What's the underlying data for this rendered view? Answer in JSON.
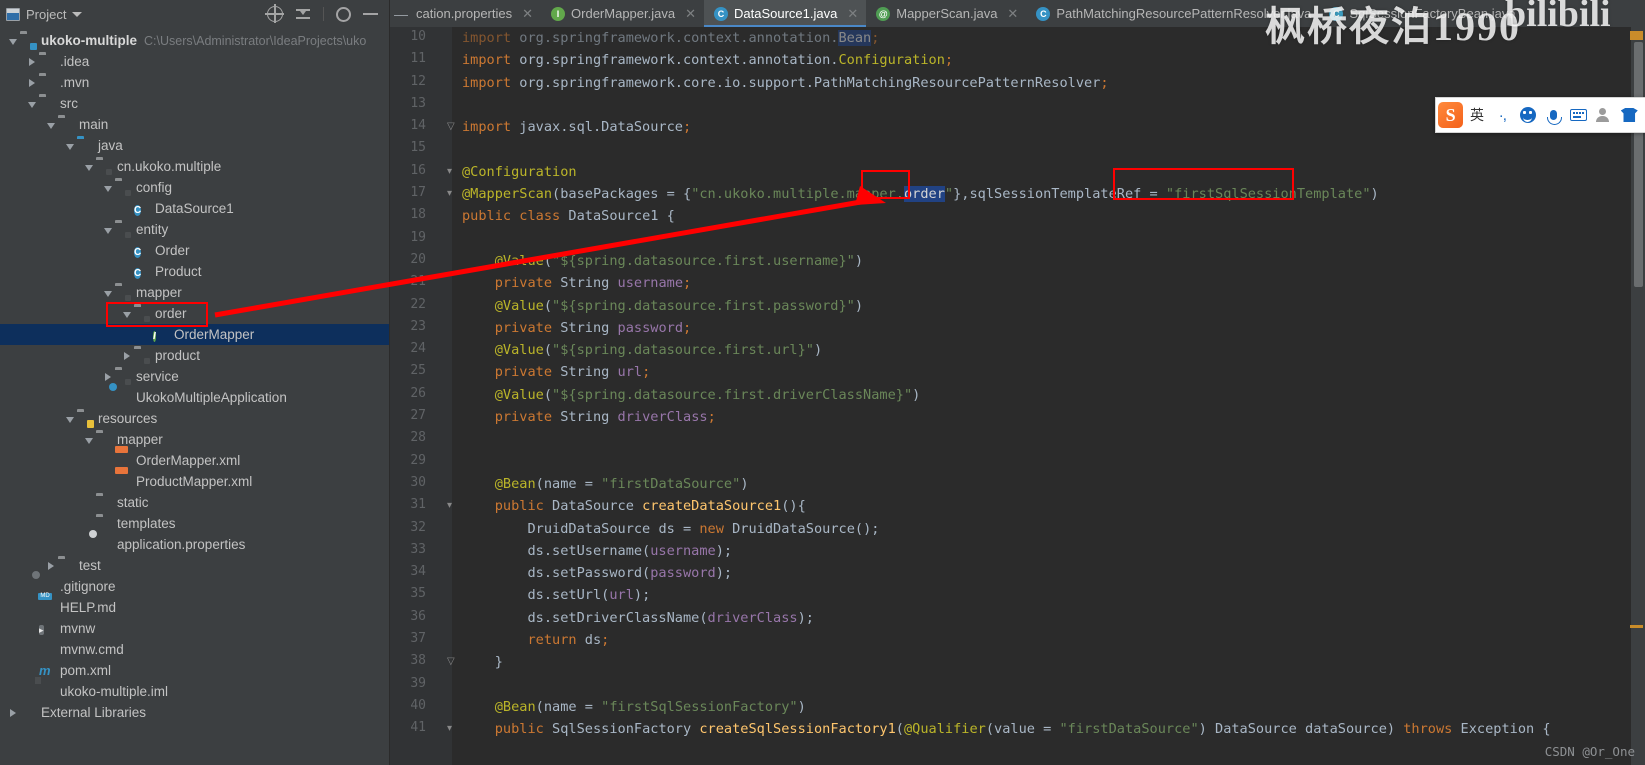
{
  "project_panel": {
    "title": "Project",
    "header_icons": [
      "locate-icon",
      "collapse-all-icon",
      "settings-icon",
      "minimize-icon"
    ],
    "tree": [
      {
        "depth": 0,
        "arrow": "down",
        "icon": "module-folder-icon",
        "label": "ukoko-multiple",
        "bold": true,
        "sub": "C:\\Users\\Administrator\\IdeaProjects\\uko"
      },
      {
        "depth": 1,
        "arrow": "right",
        "icon": "folder-icon",
        "label": ".idea"
      },
      {
        "depth": 1,
        "arrow": "right",
        "icon": "folder-icon",
        "label": ".mvn"
      },
      {
        "depth": 1,
        "arrow": "down",
        "icon": "folder-icon",
        "label": "src"
      },
      {
        "depth": 2,
        "arrow": "down",
        "icon": "folder-icon",
        "label": "main"
      },
      {
        "depth": 3,
        "arrow": "down",
        "icon": "source-folder-icon",
        "label": "java"
      },
      {
        "depth": 4,
        "arrow": "down",
        "icon": "package-icon",
        "label": "cn.ukoko.multiple"
      },
      {
        "depth": 5,
        "arrow": "down",
        "icon": "package-icon",
        "label": "config"
      },
      {
        "depth": 6,
        "arrow": "none",
        "icon": "java-class-icon",
        "label": "DataSource1"
      },
      {
        "depth": 5,
        "arrow": "down",
        "icon": "package-icon",
        "label": "entity"
      },
      {
        "depth": 6,
        "arrow": "none",
        "icon": "java-class-icon",
        "label": "Order"
      },
      {
        "depth": 6,
        "arrow": "none",
        "icon": "java-class-icon",
        "label": "Product"
      },
      {
        "depth": 5,
        "arrow": "down",
        "icon": "package-icon",
        "label": "mapper"
      },
      {
        "depth": 6,
        "arrow": "down",
        "icon": "package-icon",
        "label": "order",
        "highlighted": true
      },
      {
        "depth": 7,
        "arrow": "none",
        "icon": "java-interface-icon",
        "label": "OrderMapper",
        "selected": true
      },
      {
        "depth": 6,
        "arrow": "right",
        "icon": "package-icon",
        "label": "product"
      },
      {
        "depth": 5,
        "arrow": "right",
        "icon": "package-icon",
        "label": "service"
      },
      {
        "depth": 5,
        "arrow": "none",
        "icon": "spring-boot-icon",
        "label": "UkokoMultipleApplication"
      },
      {
        "depth": 3,
        "arrow": "down",
        "icon": "resources-folder-icon",
        "label": "resources"
      },
      {
        "depth": 4,
        "arrow": "down",
        "icon": "folder-icon",
        "label": "mapper"
      },
      {
        "depth": 5,
        "arrow": "none",
        "icon": "xml-file-icon",
        "label": "OrderMapper.xml"
      },
      {
        "depth": 5,
        "arrow": "none",
        "icon": "xml-file-icon",
        "label": "ProductMapper.xml"
      },
      {
        "depth": 4,
        "arrow": "none",
        "icon": "folder-icon",
        "label": "static"
      },
      {
        "depth": 4,
        "arrow": "none",
        "icon": "folder-icon",
        "label": "templates"
      },
      {
        "depth": 4,
        "arrow": "none",
        "icon": "properties-file-icon",
        "label": "application.properties"
      },
      {
        "depth": 2,
        "arrow": "right",
        "icon": "folder-icon",
        "label": "test"
      },
      {
        "depth": 1,
        "arrow": "none",
        "icon": "gitignore-file-icon",
        "label": ".gitignore"
      },
      {
        "depth": 1,
        "arrow": "none",
        "icon": "markdown-file-icon",
        "label": "HELP.md"
      },
      {
        "depth": 1,
        "arrow": "none",
        "icon": "shell-file-icon",
        "label": "mvnw"
      },
      {
        "depth": 1,
        "arrow": "none",
        "icon": "cmd-file-icon",
        "label": "mvnw.cmd"
      },
      {
        "depth": 1,
        "arrow": "none",
        "icon": "maven-file-icon",
        "label": "pom.xml"
      },
      {
        "depth": 1,
        "arrow": "none",
        "icon": "iml-file-icon",
        "label": "ukoko-multiple.iml"
      },
      {
        "depth": 0,
        "arrow": "right",
        "icon": "library-icon",
        "label": "External Libraries"
      }
    ]
  },
  "tabs": [
    {
      "label": "cation.properties",
      "icon": "dash-icon",
      "icon_color": "#9aa0a6",
      "active": false,
      "closable": true
    },
    {
      "label": "OrderMapper.java",
      "icon": "java-interface-icon",
      "icon_color": "#62a84b",
      "active": false,
      "closable": true
    },
    {
      "label": "DataSource1.java",
      "icon": "java-class-icon",
      "icon_color": "#3592c4",
      "active": true,
      "closable": true
    },
    {
      "label": "MapperScan.java",
      "icon": "java-annotation-icon",
      "icon_color": "#4f9d53",
      "active": false,
      "closable": true
    },
    {
      "label": "PathMatchingResourcePatternResolver.java",
      "icon": "java-class-icon",
      "icon_color": "#3592c4",
      "active": false,
      "closable": false
    },
    {
      "label": "SqlSessionFactoryBean.java",
      "icon": "java-class-icon",
      "icon_color": "#3da0c4",
      "active": false,
      "closable": false
    }
  ],
  "editor": {
    "first_line_number": 10,
    "lines": [
      {
        "n": 10,
        "dim": true,
        "tokens": [
          {
            "t": "import ",
            "c": "kw"
          },
          {
            "t": "org.springframework.context.annotation.",
            "c": "pl"
          },
          {
            "t": "Bean",
            "c": "sel"
          },
          {
            "t": ";",
            "c": "sem"
          }
        ]
      },
      {
        "n": 11,
        "tokens": [
          {
            "t": "import ",
            "c": "kw"
          },
          {
            "t": "org.springframework.context.annotation.",
            "c": "pl"
          },
          {
            "t": "Configuration",
            "c": "ann"
          },
          {
            "t": ";",
            "c": "sem"
          }
        ]
      },
      {
        "n": 12,
        "tokens": [
          {
            "t": "import ",
            "c": "kw"
          },
          {
            "t": "org.springframework.core.io.support.PathMatchingResourcePatternResolver",
            "c": "pl"
          },
          {
            "t": ";",
            "c": "sem"
          }
        ]
      },
      {
        "n": 13,
        "tokens": []
      },
      {
        "n": 14,
        "fold": "end",
        "tokens": [
          {
            "t": "import ",
            "c": "kw"
          },
          {
            "t": "javax.sql.DataSource",
            "c": "pl"
          },
          {
            "t": ";",
            "c": "sem"
          }
        ]
      },
      {
        "n": 15,
        "tokens": []
      },
      {
        "n": 16,
        "fold": "start",
        "tokens": [
          {
            "t": "@Configuration",
            "c": "ann"
          }
        ]
      },
      {
        "n": 17,
        "fold": "start",
        "tokens": [
          {
            "t": "@MapperScan",
            "c": "ann"
          },
          {
            "t": "(",
            "c": "pl"
          },
          {
            "t": "basePackages",
            "c": "pl"
          },
          {
            "t": " = {",
            "c": "pl"
          },
          {
            "t": "\"cn.ukoko.multiple.mapper.",
            "c": "str"
          },
          {
            "t": "order",
            "c": "sel-blue"
          },
          {
            "t": "\"",
            "c": "str"
          },
          {
            "t": "},",
            "c": "pl"
          },
          {
            "t": "sqlSessionTemplateRef",
            "c": "pl"
          },
          {
            "t": " = ",
            "c": "pl"
          },
          {
            "t": "\"firstSqlSessionTemplate\"",
            "c": "str"
          },
          {
            "t": ")",
            "c": "pl"
          }
        ]
      },
      {
        "n": 18,
        "mark": "bean-blue",
        "tokens": [
          {
            "t": "public ",
            "c": "kw"
          },
          {
            "t": "class ",
            "c": "kw"
          },
          {
            "t": "DataSource1",
            "c": "cls"
          },
          {
            "t": " {",
            "c": "pl"
          }
        ]
      },
      {
        "n": 19,
        "tokens": []
      },
      {
        "n": 20,
        "indent": 1,
        "tokens": [
          {
            "t": "@Value",
            "c": "ann"
          },
          {
            "t": "(",
            "c": "pl"
          },
          {
            "t": "\"${spring.datasource.first.username}\"",
            "c": "str"
          },
          {
            "t": ")",
            "c": "pl"
          }
        ]
      },
      {
        "n": 21,
        "indent": 1,
        "tokens": [
          {
            "t": "private ",
            "c": "kw"
          },
          {
            "t": "String ",
            "c": "cls"
          },
          {
            "t": "username",
            "c": "fld"
          },
          {
            "t": ";",
            "c": "sem"
          }
        ]
      },
      {
        "n": 22,
        "indent": 1,
        "tokens": [
          {
            "t": "@Value",
            "c": "ann"
          },
          {
            "t": "(",
            "c": "pl"
          },
          {
            "t": "\"${spring.datasource.first.password}\"",
            "c": "str"
          },
          {
            "t": ")",
            "c": "pl"
          }
        ]
      },
      {
        "n": 23,
        "indent": 1,
        "tokens": [
          {
            "t": "private ",
            "c": "kw"
          },
          {
            "t": "String ",
            "c": "cls"
          },
          {
            "t": "password",
            "c": "fld"
          },
          {
            "t": ";",
            "c": "sem"
          }
        ]
      },
      {
        "n": 24,
        "indent": 1,
        "tokens": [
          {
            "t": "@Value",
            "c": "ann"
          },
          {
            "t": "(",
            "c": "pl"
          },
          {
            "t": "\"${spring.datasource.first.url}\"",
            "c": "str"
          },
          {
            "t": ")",
            "c": "pl"
          }
        ]
      },
      {
        "n": 25,
        "indent": 1,
        "tokens": [
          {
            "t": "private ",
            "c": "kw"
          },
          {
            "t": "String ",
            "c": "cls"
          },
          {
            "t": "url",
            "c": "fld"
          },
          {
            "t": ";",
            "c": "sem"
          }
        ]
      },
      {
        "n": 26,
        "indent": 1,
        "tokens": [
          {
            "t": "@Value",
            "c": "ann"
          },
          {
            "t": "(",
            "c": "pl"
          },
          {
            "t": "\"${spring.datasource.first.driverClassName}\"",
            "c": "str"
          },
          {
            "t": ")",
            "c": "pl"
          }
        ]
      },
      {
        "n": 27,
        "indent": 1,
        "tokens": [
          {
            "t": "private ",
            "c": "kw"
          },
          {
            "t": "String ",
            "c": "cls"
          },
          {
            "t": "driverClass",
            "c": "fld"
          },
          {
            "t": ";",
            "c": "sem"
          }
        ]
      },
      {
        "n": 28,
        "tokens": []
      },
      {
        "n": 29,
        "tokens": []
      },
      {
        "n": 30,
        "indent": 1,
        "mark": "bean-green",
        "tokens": [
          {
            "t": "@Bean",
            "c": "ann"
          },
          {
            "t": "(",
            "c": "pl"
          },
          {
            "t": "name",
            "c": "pl"
          },
          {
            "t": " = ",
            "c": "pl"
          },
          {
            "t": "\"firstDataSource\"",
            "c": "str"
          },
          {
            "t": ")",
            "c": "pl"
          }
        ]
      },
      {
        "n": 31,
        "indent": 1,
        "fold": "start",
        "tokens": [
          {
            "t": "public ",
            "c": "kw"
          },
          {
            "t": "DataSource ",
            "c": "cls"
          },
          {
            "t": "createDataSource1",
            "c": "mth"
          },
          {
            "t": "(){",
            "c": "pl"
          }
        ]
      },
      {
        "n": 32,
        "indent": 2,
        "tokens": [
          {
            "t": "DruidDataSource ",
            "c": "cls"
          },
          {
            "t": "ds",
            "c": "pl"
          },
          {
            "t": " = ",
            "c": "pl"
          },
          {
            "t": "new ",
            "c": "kw"
          },
          {
            "t": "DruidDataSource();",
            "c": "pl"
          }
        ]
      },
      {
        "n": 33,
        "indent": 2,
        "tokens": [
          {
            "t": "ds.setUsername(",
            "c": "pl"
          },
          {
            "t": "username",
            "c": "fld"
          },
          {
            "t": ");",
            "c": "pl"
          }
        ]
      },
      {
        "n": 34,
        "indent": 2,
        "tokens": [
          {
            "t": "ds.setPassword(",
            "c": "pl"
          },
          {
            "t": "password",
            "c": "fld"
          },
          {
            "t": ");",
            "c": "pl"
          }
        ]
      },
      {
        "n": 35,
        "indent": 2,
        "tokens": [
          {
            "t": "ds.setUrl(",
            "c": "pl"
          },
          {
            "t": "url",
            "c": "fld"
          },
          {
            "t": ");",
            "c": "pl"
          }
        ]
      },
      {
        "n": 36,
        "indent": 2,
        "tokens": [
          {
            "t": "ds.setDriverClassName(",
            "c": "pl"
          },
          {
            "t": "driverClass",
            "c": "fld"
          },
          {
            "t": ");",
            "c": "pl"
          }
        ]
      },
      {
        "n": 37,
        "indent": 2,
        "tokens": [
          {
            "t": "return ",
            "c": "kw"
          },
          {
            "t": "ds",
            "c": "pl"
          },
          {
            "t": ";",
            "c": "sem"
          }
        ]
      },
      {
        "n": 38,
        "indent": 1,
        "fold": "end",
        "tokens": [
          {
            "t": "}",
            "c": "pl"
          }
        ]
      },
      {
        "n": 39,
        "tokens": []
      },
      {
        "n": 40,
        "indent": 1,
        "mark": "bean-green",
        "tokens": [
          {
            "t": "@Bean",
            "c": "ann"
          },
          {
            "t": "(",
            "c": "pl"
          },
          {
            "t": "name",
            "c": "pl"
          },
          {
            "t": " = ",
            "c": "pl"
          },
          {
            "t": "\"firstSqlSessionFactory\"",
            "c": "str"
          },
          {
            "t": ")",
            "c": "pl"
          }
        ]
      },
      {
        "n": 41,
        "indent": 1,
        "mark": "bean-green2",
        "fold": "start",
        "tokens": [
          {
            "t": "public ",
            "c": "kw"
          },
          {
            "t": "SqlSessionFactory ",
            "c": "cls"
          },
          {
            "t": "createSqlSessionFactory1",
            "c": "mth"
          },
          {
            "t": "(",
            "c": "pl"
          },
          {
            "t": "@Qualifier",
            "c": "ann"
          },
          {
            "t": "(",
            "c": "pl"
          },
          {
            "t": "value",
            "c": "pl"
          },
          {
            "t": " = ",
            "c": "pl"
          },
          {
            "t": "\"firstDataSource\"",
            "c": "str"
          },
          {
            "t": ") DataSource dataSource) ",
            "c": "pl"
          },
          {
            "t": "throws ",
            "c": "kw"
          },
          {
            "t": "Exception {",
            "c": "pl"
          }
        ]
      }
    ]
  },
  "annotations": {
    "red_box_order_tree": "highlights the 'order' package in project tree",
    "red_box_order_code": "highlights the 'order' token in @MapperScan basePackages",
    "red_box_template": "highlights firstSqlSessionTemplate string",
    "red_arrow": "points from the @MapperScan 'order' token down-left to the 'order' package node"
  },
  "ime_bar": {
    "logo": "S",
    "mode_label": "英",
    "items": [
      "sogou-logo-icon",
      "input-mode-label",
      "punctuation-icon",
      "emoji-icon",
      "voice-input-icon",
      "soft-keyboard-icon",
      "user-icon",
      "skin-icon"
    ]
  },
  "watermarks": {
    "overlay_text": "枫桥夜泊1990",
    "bilibili_text": "bilibili",
    "csdn": "CSDN @Or_One"
  },
  "colors": {
    "editor_bg": "#2b2b2b",
    "panel_bg": "#3c3f41",
    "gutter_bg": "#313335",
    "selection_blue": "#214283",
    "tree_selection": "#0d2f5c",
    "annotation_red": "#ff0000",
    "tab_active_underline": "#4a88c7",
    "keyword_orange": "#cc7832",
    "string_green": "#6a8759",
    "annotation_yellow": "#bbb529",
    "field_purple": "#9876aa",
    "method_yellow": "#ffc66d"
  }
}
